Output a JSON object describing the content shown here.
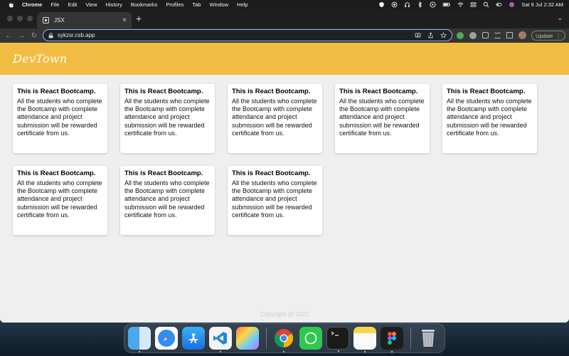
{
  "menubar": {
    "items": [
      "Chrome",
      "File",
      "Edit",
      "View",
      "History",
      "Bookmarks",
      "Profiles",
      "Tab",
      "Window",
      "Help"
    ],
    "datetime": "Sat 9 Jul  2:32 AM"
  },
  "browser": {
    "tab_title": "JSX",
    "tab_close": "×",
    "new_tab": "+",
    "tab_menu": "⌄",
    "url": "sykzsr.csb.app",
    "update_label": "Update",
    "update_more": "⋮",
    "nav": {
      "back": "←",
      "forward": "→",
      "reload": "↻"
    }
  },
  "page": {
    "logo": "DevTown",
    "cards": [
      {
        "title": "This is React Bootcamp.",
        "body": "All the students who complete the Bootcamp with complete attendance and project submission will be rewarded certificate from us."
      },
      {
        "title": "This is React Bootcamp.",
        "body": "All the students who complete the Bootcamp with complete attendance and project submission will be rewarded certificate from us."
      },
      {
        "title": "This is React Bootcamp.",
        "body": "All the students who complete the Bootcamp with complete attendance and project submission will be rewarded certificate from us."
      },
      {
        "title": "This is React Bootcamp.",
        "body": "All the students who complete the Bootcamp with complete attendance and project submission will be rewarded certificate from us."
      },
      {
        "title": "This is React Bootcamp.",
        "body": "All the students who complete the Bootcamp with complete attendance and project submission will be rewarded certificate from us."
      },
      {
        "title": "This is React Bootcamp.",
        "body": "All the students who complete the Bootcamp with complete attendance and project submission will be rewarded certificate from us."
      },
      {
        "title": "This is React Bootcamp.",
        "body": "All the students who complete the Bootcamp with complete attendance and project submission will be rewarded certificate from us."
      },
      {
        "title": "This is React Bootcamp.",
        "body": "All the students who complete the Bootcamp with complete attendance and project submission will be rewarded certificate from us."
      }
    ],
    "footer": "Copyright @ 2022"
  },
  "dock": {
    "apps": [
      "finder-icon",
      "safari-icon",
      "app-store-icon",
      "vscode-icon",
      "final-cut-icon",
      "chrome-icon",
      "whatsapp-icon",
      "terminal-icon",
      "notes-icon",
      "figma-icon",
      "trash-icon"
    ]
  },
  "colors": {
    "navbar": "#f2bd43",
    "page_bg": "#efefef",
    "omnibox_border": "#8ab4f8"
  }
}
